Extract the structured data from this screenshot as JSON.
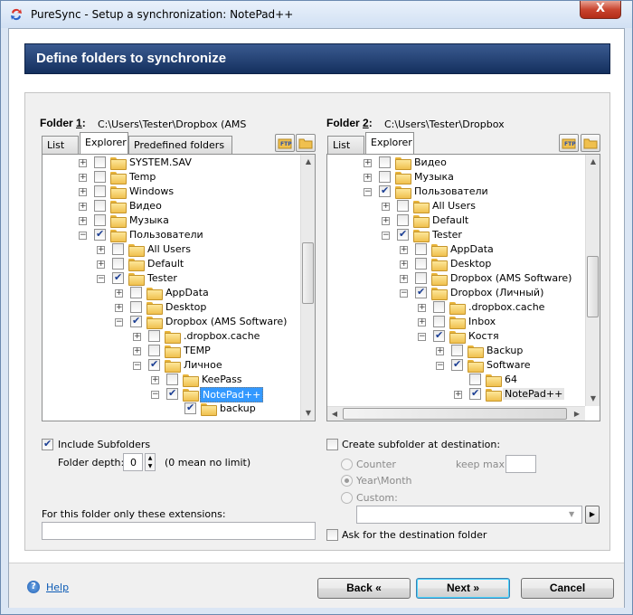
{
  "window": {
    "title": "PureSync - Setup a synchronization: NotePad++",
    "close_label": "X"
  },
  "header": {
    "title": "Define folders to synchronize"
  },
  "left": {
    "label_prefix": "Folder ",
    "label_num": "1",
    "label_suffix": ":",
    "path": "C:\\Users\\Tester\\Dropbox (AMS",
    "tabs": [
      "List",
      "Explorer",
      "Predefined folders"
    ],
    "tree": [
      {
        "label": "SYSTEM.SAV",
        "exp": "+",
        "checked": false
      },
      {
        "label": "Temp",
        "exp": "+",
        "checked": false
      },
      {
        "label": "Windows",
        "exp": "+",
        "checked": false
      },
      {
        "label": "Видео",
        "exp": "+",
        "checked": false
      },
      {
        "label": "Музыка",
        "exp": "+",
        "checked": false
      },
      {
        "label": "Пользователи",
        "exp": "-",
        "checked": true
      },
      {
        "label": "All Users",
        "exp": "+",
        "checked": false
      },
      {
        "label": "Default",
        "exp": "+",
        "checked": false
      },
      {
        "label": "Tester",
        "exp": "-",
        "checked": true
      },
      {
        "label": "AppData",
        "exp": "+",
        "checked": false
      },
      {
        "label": "Desktop",
        "exp": "+",
        "checked": false
      },
      {
        "label": "Dropbox (AMS Software)",
        "exp": "-",
        "checked": true
      },
      {
        "label": ".dropbox.cache",
        "exp": "+",
        "checked": false
      },
      {
        "label": "TEMP",
        "exp": "+",
        "checked": false
      },
      {
        "label": "Личное",
        "exp": "-",
        "checked": true
      },
      {
        "label": "KeePass",
        "exp": "+",
        "checked": false
      },
      {
        "label": "NotePad++",
        "exp": "-",
        "checked": true,
        "selected": true
      },
      {
        "label": "backup",
        "exp": "",
        "checked": true
      }
    ],
    "include_subfolders": "Include Subfolders",
    "folder_depth_label": "Folder depth:",
    "folder_depth_value": "0",
    "folder_depth_hint": "(0 mean no limit)",
    "extensions_label": "For this folder only these extensions:",
    "extensions_value": ""
  },
  "right": {
    "label_prefix": "Folder ",
    "label_num": "2",
    "label_suffix": ":",
    "path": "C:\\Users\\Tester\\Dropbox",
    "tabs": [
      "List",
      "Explorer"
    ],
    "tree": [
      {
        "label": "Видео",
        "exp": "+",
        "checked": false
      },
      {
        "label": "Музыка",
        "exp": "+",
        "checked": false
      },
      {
        "label": "Пользователи",
        "exp": "-",
        "checked": true
      },
      {
        "label": "All Users",
        "exp": "+",
        "checked": false
      },
      {
        "label": "Default",
        "exp": "+",
        "checked": false
      },
      {
        "label": "Tester",
        "exp": "-",
        "checked": true
      },
      {
        "label": "AppData",
        "exp": "+",
        "checked": false
      },
      {
        "label": "Desktop",
        "exp": "+",
        "checked": false
      },
      {
        "label": "Dropbox (AMS Software)",
        "exp": "+",
        "checked": false
      },
      {
        "label": "Dropbox (Личный)",
        "exp": "-",
        "checked": true
      },
      {
        "label": ".dropbox.cache",
        "exp": "+",
        "checked": false
      },
      {
        "label": "Inbox",
        "exp": "+",
        "checked": false
      },
      {
        "label": "Костя",
        "exp": "-",
        "checked": true
      },
      {
        "label": "Backup",
        "exp": "+",
        "checked": false
      },
      {
        "label": "Software",
        "exp": "-",
        "checked": true
      },
      {
        "label": "64",
        "exp": "",
        "checked": false
      },
      {
        "label": "NotePad++",
        "exp": "+",
        "checked": true,
        "highlight": true
      }
    ],
    "create_subfolder": "Create subfolder at destination:",
    "counter": "Counter",
    "year_month": "Year\\Month",
    "custom": "Custom:",
    "keep_max": "keep max:",
    "ask_destination": "Ask for the destination folder"
  },
  "footer": {
    "help": "Help",
    "back": "Back «",
    "next": "Next »",
    "cancel": "Cancel"
  }
}
